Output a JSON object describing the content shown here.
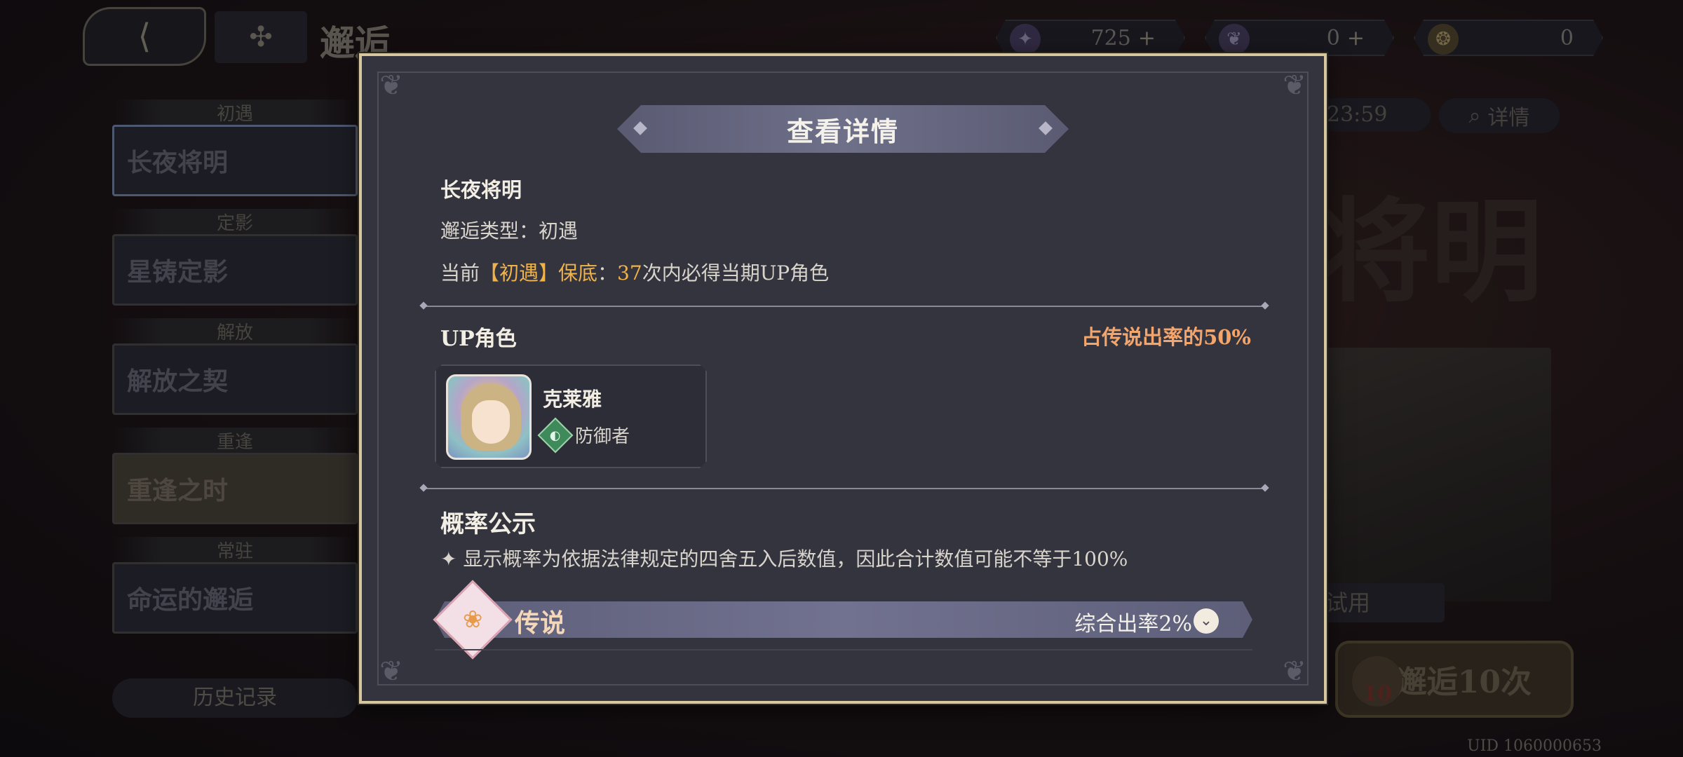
{
  "background": {
    "title": "邂逅",
    "currencies": [
      {
        "icon": "star-crystal-icon",
        "value": "725",
        "has_plus": true
      },
      {
        "icon": "feather-ticket-icon",
        "value": "0",
        "has_plus": true
      },
      {
        "icon": "gold-ticket-icon",
        "value": "0",
        "has_plus": false
      }
    ],
    "banners": [
      {
        "label": "初遇",
        "card_text": "长夜将明"
      },
      {
        "label": "定影",
        "card_text": "星铸定影"
      },
      {
        "label": "解放",
        "card_text": "解放之契"
      },
      {
        "label": "重逢",
        "card_text": "重逢之时"
      },
      {
        "label": "常驻",
        "card_text": "命运的邂逅"
      }
    ],
    "history_label": "历史记录",
    "timer_text": "23:59",
    "detail_label": "详情",
    "big_title": "将明",
    "trial_label": "试用",
    "summon10_label": "邂逅10次",
    "summon10_badge": "10",
    "uid": "UID 1060000653"
  },
  "modal": {
    "title": "查看详情",
    "banner_name": "长夜将明",
    "banner_type_label": "邂逅类型：",
    "banner_type_value": "初遇",
    "pity_prefix": "当前",
    "pity_accent": "【初遇】保底",
    "pity_colon": "：",
    "pity_count": "37",
    "pity_suffix": "次内必得当期UP角色",
    "up_heading": "UP角色",
    "up_rate": "占传说出率的50%",
    "character": {
      "name": "克莱雅",
      "role": "防御者"
    },
    "prob_heading": "概率公示",
    "prob_note": "✦ 显示概率为依据法律规定的四舍五入后数值，因此合计数值可能不等于100%",
    "tier": {
      "name": "传说",
      "rate": "综合出率2%"
    }
  },
  "colors": {
    "accent_orange": "#f0b24a",
    "up_rate": "#f3a56b",
    "modal_border": "#d6c79f",
    "modal_bg": "#34343f"
  }
}
